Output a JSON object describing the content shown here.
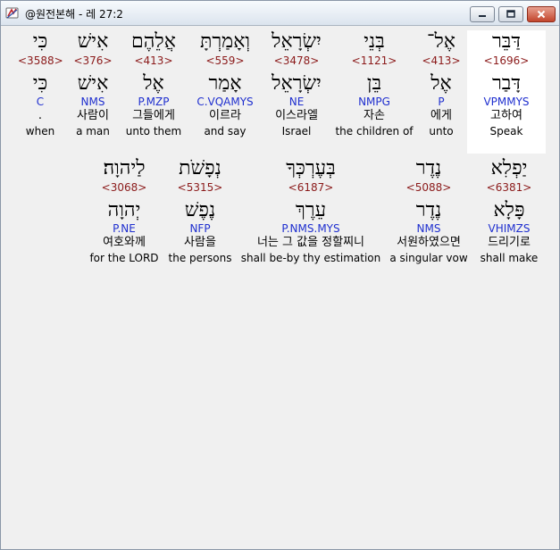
{
  "window": {
    "title": "@원전본해 - 레 27:2"
  },
  "rows": [
    {
      "words": [
        {
          "heb": "דַּבֵּר",
          "strong": "<1696>",
          "lemma": "דָּבַר",
          "morph": "VPMMYS",
          "kor": "고하여",
          "eng": "Speak"
        },
        {
          "heb": "אֶל־",
          "strong": "<413>",
          "lemma": "אֶל",
          "morph": "P",
          "kor": "에게",
          "eng": "unto"
        },
        {
          "heb": "בְּנֵי",
          "strong": "<1121>",
          "lemma": "בֵּן",
          "morph": "NMPG",
          "kor": "자손",
          "eng": "the children of"
        },
        {
          "heb": "יִשְׂרָאֵל",
          "strong": "<3478>",
          "lemma": "יִשְׂרָאֵל",
          "morph": "NE",
          "kor": "이스라엘",
          "eng": "Israel"
        },
        {
          "heb": "וְאָמַרְתָּ",
          "strong": "<559>",
          "lemma": "אָמַר",
          "morph": "C.VQAMYS",
          "kor": "이르라",
          "eng": "and say"
        },
        {
          "heb": "אֲלֵהֶם",
          "strong": "<413>",
          "lemma": "אֶל",
          "morph": "P.MZP",
          "kor": "그들에게",
          "eng": "unto them"
        },
        {
          "heb": "אִישׁ",
          "strong": "<376>",
          "lemma": "אִישׁ",
          "morph": "NMS",
          "kor": "사람이",
          "eng": "a man"
        },
        {
          "heb": "כִּי",
          "strong": "<3588>",
          "lemma": "כִּי",
          "morph": "C",
          "kor": ".",
          "eng": "when"
        }
      ]
    },
    {
      "words": [
        {
          "heb": "יַפְלִא",
          "strong": "<6381>",
          "lemma": "פָּלָא",
          "morph": "VHIMZS",
          "kor": "드리기로",
          "eng": "shall make"
        },
        {
          "heb": "נֶדֶר",
          "strong": "<5088>",
          "lemma": "נֶדֶר",
          "morph": "NMS",
          "kor": "서원하였으면",
          "eng": "a singular vow"
        },
        {
          "heb": "בְּעֶרְכְּךָ",
          "strong": "<6187>",
          "lemma": "עֵרֶךְ",
          "morph": "P.NMS.MYS",
          "kor": "너는 그 값을 정할찌니",
          "eng": "shall be-by thy estimation"
        },
        {
          "heb": "נְפָשֹׁת",
          "strong": "<5315>",
          "lemma": "נֶפֶשׁ",
          "morph": "NFP",
          "kor": "사람을",
          "eng": "the persons"
        },
        {
          "heb": "לַיהוָה׃",
          "strong": "<3068>",
          "lemma": "יְהוָה",
          "morph": "P.NE",
          "kor": "여호와께",
          "eng": "for the LORD"
        }
      ]
    }
  ]
}
